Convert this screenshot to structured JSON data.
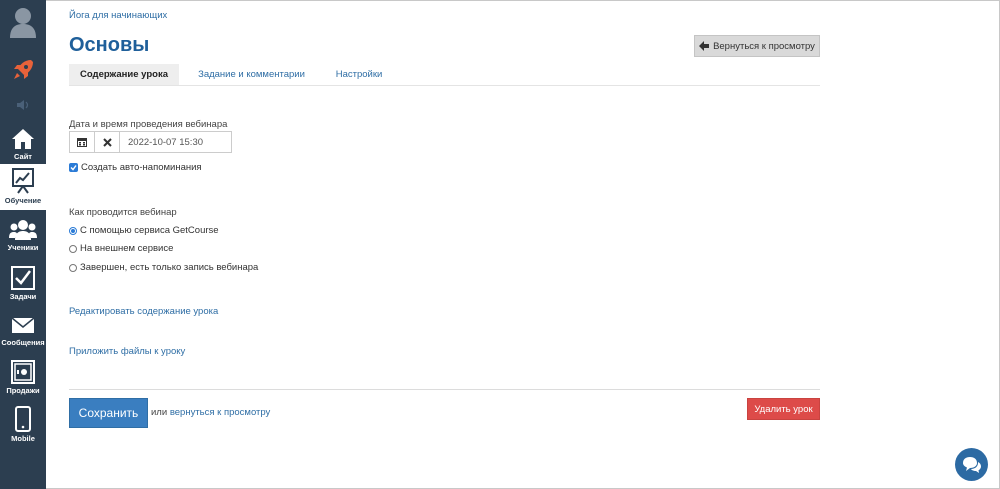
{
  "sidebar": {
    "items": [
      {
        "label": "Сайт",
        "icon": "home-icon"
      },
      {
        "label": "Обучение",
        "icon": "chart-board-icon"
      },
      {
        "label": "Ученики",
        "icon": "users-icon"
      },
      {
        "label": "Задачи",
        "icon": "checkbox-icon"
      },
      {
        "label": "Сообщения",
        "icon": "envelope-icon"
      },
      {
        "label": "Продажи",
        "icon": "safe-icon"
      },
      {
        "label": "Mobile",
        "icon": "mobile-icon"
      }
    ],
    "active": "Обучение",
    "colors": {
      "bg": "#2c3e50",
      "rocket": "#e8623a"
    }
  },
  "breadcrumb": "Йога для начинающих",
  "page_title": "Основы",
  "back_button": "Вернуться к просмотру",
  "tabs": [
    {
      "label": "Содержание урока",
      "active": true
    },
    {
      "label": "Задание и комментарии",
      "active": false
    },
    {
      "label": "Настройки",
      "active": false
    }
  ],
  "webinar": {
    "datetime_label": "Дата и время проведения вебинара",
    "datetime_value": "2022-10-07 15:30",
    "reminder_label": "Создать авто-напоминания",
    "reminder_checked": true,
    "how_label": "Как проводится вебинар",
    "options": [
      {
        "label": "С помощью сервиса GetCourse",
        "selected": true
      },
      {
        "label": "На внешнем сервисе",
        "selected": false
      },
      {
        "label": "Завершен, есть только запись вебинара",
        "selected": false
      }
    ]
  },
  "links": {
    "edit_content": "Редактировать содержание урока",
    "attach_files": "Приложить файлы к уроку"
  },
  "footer": {
    "save": "Сохранить",
    "or_text": "или",
    "back_link": "вернуться к просмотру",
    "delete": "Удалить урок"
  },
  "colors": {
    "primary": "#3a7ec0",
    "danger": "#dd4b49",
    "link": "#2f6ea5",
    "title": "#1f5f9a"
  }
}
